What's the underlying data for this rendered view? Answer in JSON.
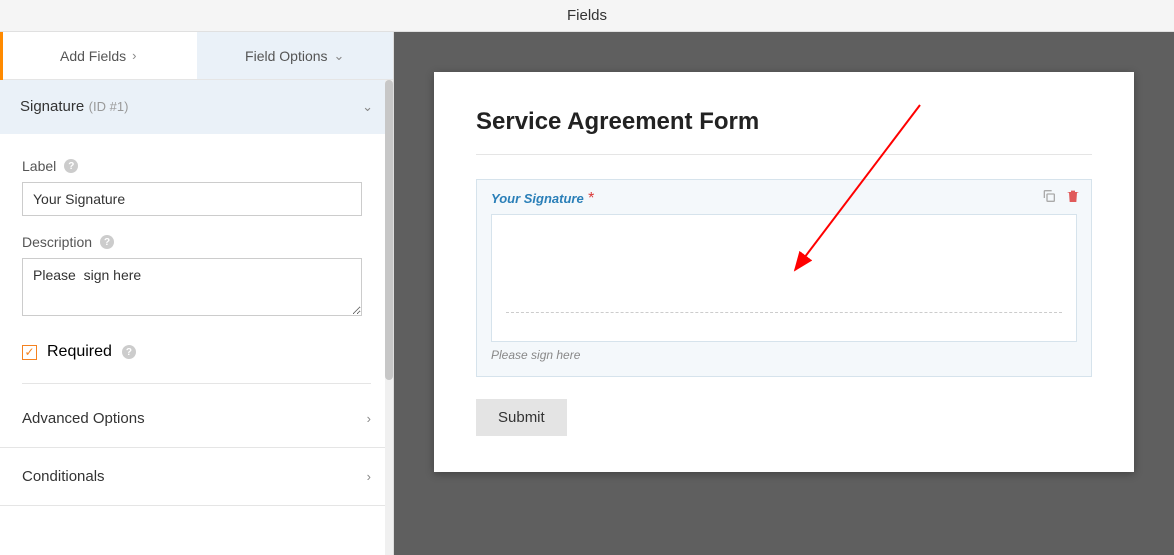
{
  "header": {
    "title": "Fields"
  },
  "tabs": {
    "add_fields": "Add Fields",
    "field_options": "Field Options"
  },
  "section": {
    "title": "Signature",
    "id_text": "(ID #1)"
  },
  "label_field": {
    "label": "Label",
    "value": "Your Signature"
  },
  "description_field": {
    "label": "Description",
    "value": "Please  sign here"
  },
  "required": {
    "label": "Required",
    "checked": true
  },
  "advanced_options": "Advanced Options",
  "conditionals": "Conditionals",
  "preview": {
    "form_title": "Service Agreement Form",
    "field_label": "Your Signature",
    "required_mark": "*",
    "description": "Please sign here",
    "submit_label": "Submit"
  },
  "icons": {
    "help": "?",
    "chevron_right": "›",
    "chevron_down": "⌄"
  }
}
